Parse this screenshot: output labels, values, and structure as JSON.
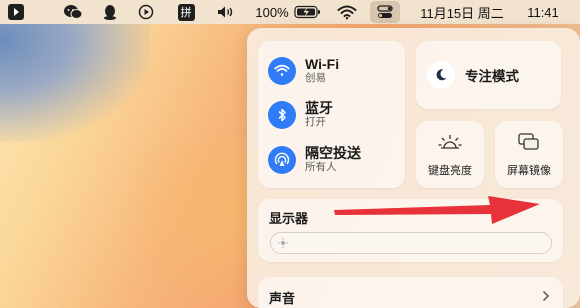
{
  "menubar": {
    "battery_percent": "100%",
    "date": "11月15日 周二",
    "time": "11:41",
    "input_method": "拼",
    "icons": [
      "app-icon",
      "wechat-icon",
      "qq-icon",
      "play-icon",
      "input-method-icon",
      "volume-icon",
      "battery-charging-icon",
      "wifi-icon",
      "control-center-icon"
    ]
  },
  "control_center": {
    "wifi": {
      "title": "Wi-Fi",
      "subtitle": "创易"
    },
    "bluetooth": {
      "title": "蓝牙",
      "subtitle": "打开"
    },
    "airdrop": {
      "title": "隔空投送",
      "subtitle": "所有人"
    },
    "focus": {
      "label": "专注模式"
    },
    "keyboard_brightness": {
      "label": "键盘亮度"
    },
    "screen_mirroring": {
      "label": "屏幕镜像"
    },
    "display": {
      "title": "显示器"
    },
    "sound": {
      "title": "声音"
    }
  },
  "colors": {
    "accent_blue": "#2f7cf6",
    "arrow_red": "#e8323a"
  }
}
